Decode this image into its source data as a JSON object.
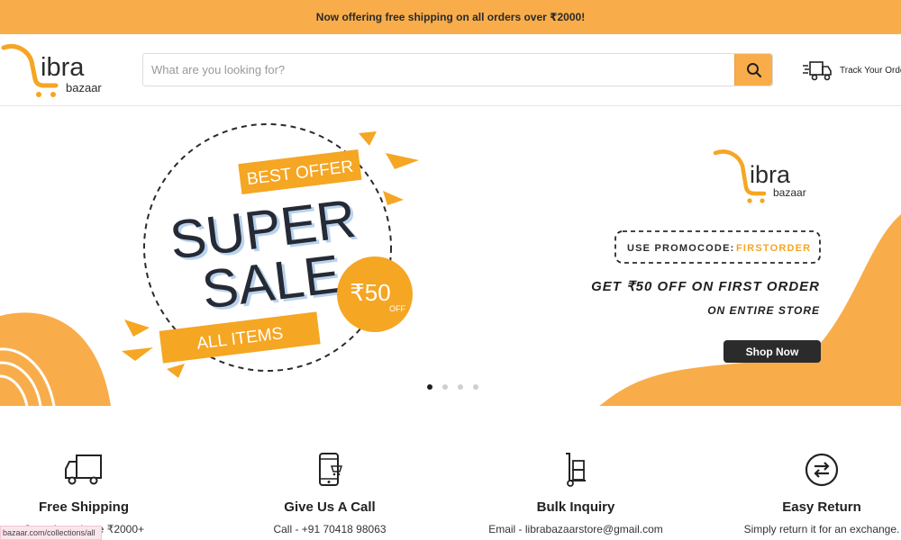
{
  "announcement": "Now offering free shipping on all orders over ₹2000!",
  "logo": {
    "primary": "ibra",
    "secondary": "bazaar"
  },
  "search": {
    "placeholder": "What are you looking for?"
  },
  "track_order": "Track Your Orde",
  "hero": {
    "badge_top": "BEST OFFER",
    "headline_1": "SUPER",
    "headline_2": "SALE",
    "badge_bottom": "ALL ITEMS",
    "price_circle": "₹50",
    "price_circle_sub": "OFF",
    "brand": {
      "primary": "ibra",
      "secondary": "bazaar"
    },
    "promo_label": "USE PROMOCODE:",
    "promo_code": "FIRSTORDER",
    "offer_line_1": "GET ₹50 OFF ON FIRST ORDER",
    "offer_line_2": "ON ENTIRE STORE",
    "cta": "Shop Now",
    "slide_count": 4,
    "active_slide": 1
  },
  "features": [
    {
      "title": "Free Shipping",
      "desc": "On orders above ₹2000+",
      "icon": "truck-icon"
    },
    {
      "title": "Give Us A Call",
      "desc": "Call - +91 70418 98063",
      "icon": "phone-icon"
    },
    {
      "title": "Bulk Inquiry",
      "desc": "Email - librabazaarstore@gmail.com",
      "icon": "hand-truck-icon"
    },
    {
      "title": "Easy Return",
      "desc": "Simply return it for an exchange.",
      "icon": "return-icon"
    }
  ],
  "status_url": "bazaar.com/collections/all",
  "colors": {
    "accent": "#f8ad4a",
    "orange": "#f5a623",
    "dark": "#2b2b2b"
  }
}
